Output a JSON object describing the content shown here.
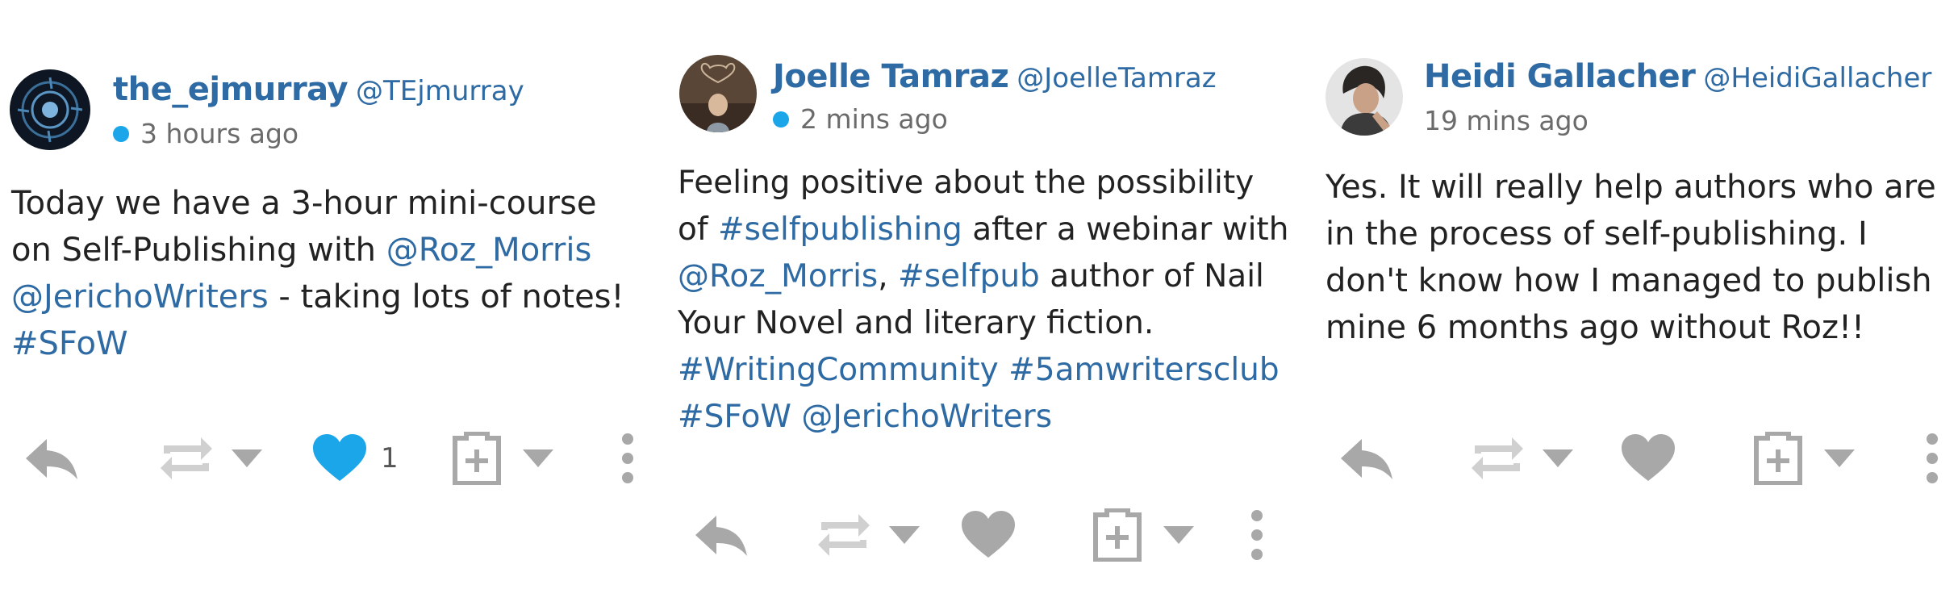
{
  "posts": [
    {
      "display_name": "the_ejmurray",
      "handle": "@TEjmurray",
      "timestamp": "3 hours ago",
      "online": true,
      "body": [
        {
          "text": "Today we have a 3-hour mini-course on Self-Publishing with "
        },
        {
          "text": "@Roz_Morris",
          "link": true
        },
        {
          "text": " "
        },
        {
          "text": "@JerichoWriters",
          "link": true
        },
        {
          "text": " - taking lots of notes! "
        },
        {
          "text": "#SFoW",
          "link": true
        }
      ],
      "liked": true,
      "like_count": "1"
    },
    {
      "display_name": "Joelle Tamraz",
      "handle": "@JoelleTamraz",
      "timestamp": "2 mins ago",
      "online": true,
      "body": [
        {
          "text": "Feeling positive about the possibility of "
        },
        {
          "text": "#selfpublishing",
          "link": true
        },
        {
          "text": " after a webinar with "
        },
        {
          "text": "@Roz_Morris",
          "link": true
        },
        {
          "text": ", "
        },
        {
          "text": "#selfpub",
          "link": true
        },
        {
          "text": " author of Nail Your Novel and literary fiction. "
        },
        {
          "text": "#WritingCommunity",
          "link": true
        },
        {
          "text": " "
        },
        {
          "text": "#5amwritersclub",
          "link": true
        },
        {
          "text": " "
        },
        {
          "text": "#SFoW",
          "link": true
        },
        {
          "text": " "
        },
        {
          "text": "@JerichoWriters",
          "link": true
        }
      ],
      "liked": false,
      "like_count": ""
    },
    {
      "display_name": "Heidi Gallacher",
      "handle": "@HeidiGallacher",
      "timestamp": "19 mins ago",
      "online": false,
      "body": [
        {
          "text": "Yes. It will really help authors who are in the process of self-publishing.  I don't know how I managed to publish mine 6 months ago without Roz!!"
        }
      ],
      "liked": false,
      "like_count": ""
    }
  ],
  "colors": {
    "link": "#2e6aa3",
    "online_dot": "#1aa6e8",
    "liked_heart": "#1aa6e8",
    "icon_gray": "#a8a8a8"
  },
  "icons": [
    "reply-icon",
    "boost-icon",
    "chevron-down-icon",
    "heart-icon",
    "bookmark-icon",
    "more-icon"
  ]
}
